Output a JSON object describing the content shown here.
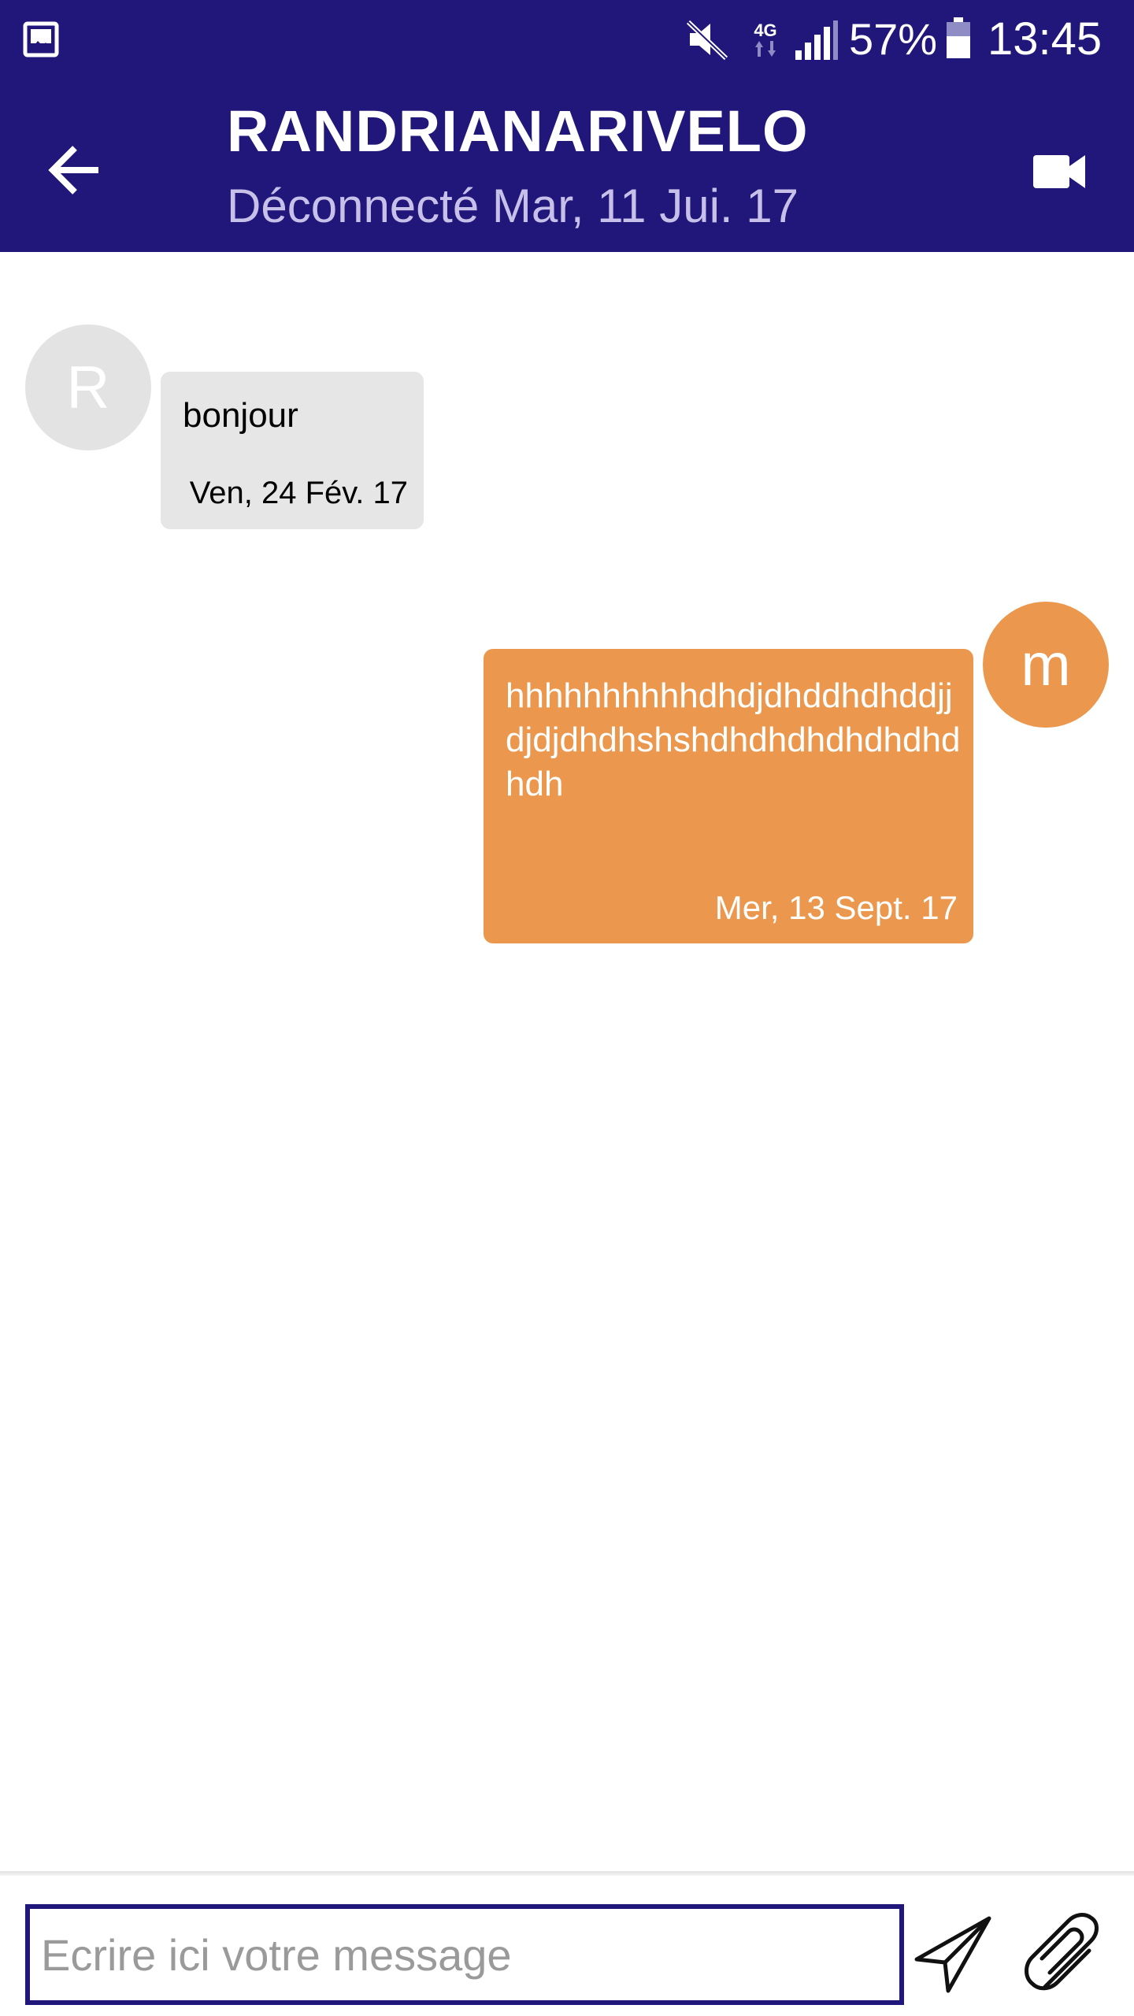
{
  "status_bar": {
    "battery_percent": "57%",
    "time": "13:45",
    "icons": [
      "gallery-icon",
      "mute-icon",
      "network-4g-icon",
      "signal-icon",
      "battery-icon"
    ]
  },
  "header": {
    "title": "RANDRIANARIVELO",
    "subtitle": "Déconnecté Mar, 11 Jui. 17",
    "icons": [
      "back-arrow-icon",
      "video-camera-icon"
    ]
  },
  "messages": [
    {
      "direction": "incoming",
      "avatar_letter": "R",
      "text": "bonjour",
      "time": "Ven, 24 Fév. 17"
    },
    {
      "direction": "outgoing",
      "avatar_letter": "m",
      "text": "hhhhhhhhhhdhdjdhddhdhddjjdjdjdhdhshshdhdhdhdhdhdhdhdh",
      "time": "Mer, 13 Sept. 17"
    }
  ],
  "composer": {
    "placeholder": "Ecrire ici votre message",
    "value": "",
    "icons": [
      "send-icon",
      "paperclip-icon"
    ]
  },
  "colors": {
    "primary": "#21177a",
    "outgoing_bubble": "#eb984e",
    "incoming_bubble": "#e6e6e6",
    "incoming_avatar": "#e3e3e3"
  }
}
